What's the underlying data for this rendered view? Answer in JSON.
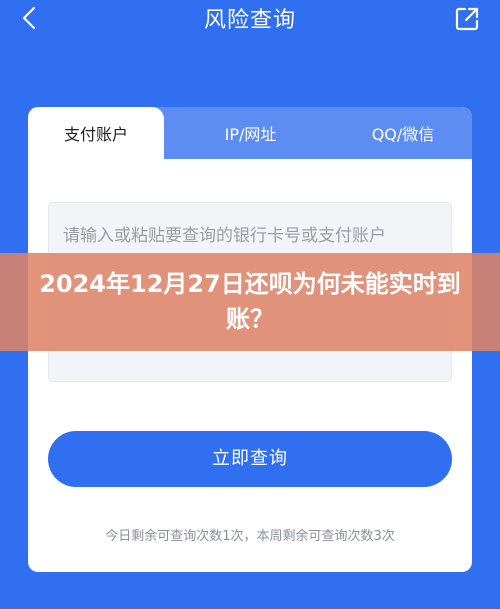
{
  "header": {
    "title": "风险查询",
    "back_icon": "chevron-left-icon",
    "share_icon": "external-link-icon"
  },
  "tabs": [
    {
      "label": "支付账户",
      "active": true
    },
    {
      "label": "IP/网址",
      "active": false
    },
    {
      "label": "QQ/微信",
      "active": false
    }
  ],
  "input": {
    "placeholder": "请输入或粘贴要查询的银行卡号或支付账户",
    "value": ""
  },
  "query_button": {
    "label": "立即查询"
  },
  "remaining_text": "今日剩余可查询次数1次，本周剩余可查询次数3次",
  "overlay": {
    "text": "2024年12月27日还呗为何未能实时到账？"
  },
  "colors": {
    "background": "#2f6ff0",
    "tab_bar": "#5d8cf2",
    "overlay": "#de8468",
    "button": "#2f6ff0"
  }
}
